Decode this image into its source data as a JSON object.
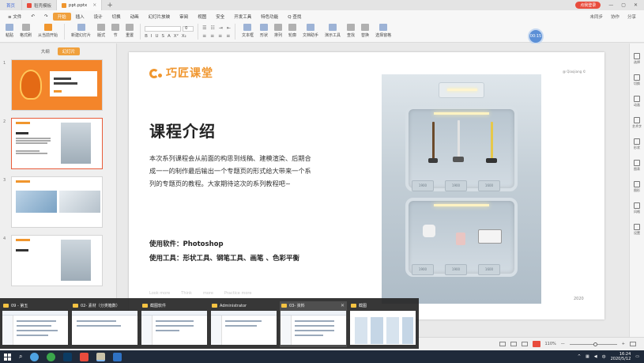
{
  "titlebar": {
    "tabs": [
      {
        "label": "首页",
        "kind": "home"
      },
      {
        "label": "稻壳模板",
        "kind": "docer",
        "color": "#e84c3d"
      },
      {
        "label": "ppt.pptx",
        "kind": "doc",
        "color": "#f0962e"
      }
    ],
    "new_tab": "+",
    "right": {
      "login": "点我登录",
      "badge": "1"
    }
  },
  "menubar": {
    "file": "≡ 文件",
    "items": [
      "开始",
      "插入",
      "设计",
      "切换",
      "动画",
      "幻灯片放映",
      "审阅",
      "视图",
      "安全",
      "开发工具",
      "特色功能"
    ],
    "active": "开始",
    "search": "Q 查找",
    "right": [
      "未同步",
      "协作",
      "分享"
    ]
  },
  "ribbon": {
    "groups": [
      "粘贴",
      "格式刷",
      "当前开始",
      "从当前开始",
      "新建幻灯片",
      "版式",
      "节",
      "重置"
    ],
    "font_placeholder": "",
    "font_size": "0",
    "format_buttons": [
      "B",
      "I",
      "U",
      "S",
      "A",
      "X²",
      "X₂"
    ],
    "right_groups": [
      "文本框",
      "形状",
      "排列",
      "轮廓",
      "文档助手",
      "演示工具",
      "查找",
      "替换",
      "选择窗格"
    ],
    "timer": "00:15"
  },
  "leftpanel": {
    "tabs": [
      "大纲",
      "幻灯片"
    ],
    "active_tab": "幻灯片",
    "slides": [
      {
        "num": "1",
        "title": "电商首页\n松下纤体专题页"
      },
      {
        "num": "2",
        "title": "课程介绍"
      },
      {
        "num": "3",
        "title": ""
      },
      {
        "num": "4",
        "title": "软件及形状"
      }
    ]
  },
  "slide": {
    "brand": "巧匠课堂",
    "copyright": "@ Qiaojiang ©",
    "title": "课程介绍",
    "body": "本次系列课程会从前面的构思到线稿、建模渲染、后期合成一一的制作最后输出一个专题页的形式给大带来一个系列的专题页的教程。大家期待这次的系列教程吧~",
    "software": "使用软件：Photoshop",
    "tools": "使用工具：形状工具、钢笔工具、画笔 、色彩平衡",
    "footer_ghost": [
      "Look more",
      "Think",
      "more",
      "Practice more"
    ],
    "year": "2020",
    "drawer_labels": [
      "1900",
      "1900",
      "1600",
      "1900",
      "1900",
      "1600"
    ]
  },
  "rightbar": {
    "items": [
      "选择",
      "切换",
      "动画",
      "艺术字",
      "形状",
      "图表",
      "图形",
      "风格",
      "设置"
    ]
  },
  "statusbar": {
    "zoom": "110%",
    "zoom_minus": "—",
    "zoom_plus": "+"
  },
  "switcher": {
    "windows": [
      {
        "title": "09 - 第五",
        "closeable": false
      },
      {
        "title": "02- 素材（分类箱数）",
        "closeable": false
      },
      {
        "title": "截图软件",
        "closeable": false
      },
      {
        "title": "Administrator",
        "closeable": false
      },
      {
        "title": "03- 资料",
        "closeable": true
      },
      {
        "title": "截图",
        "closeable": false
      }
    ]
  },
  "taskbar": {
    "time": "16:24",
    "date": "2020/5/12",
    "lang": "中",
    "app_colors": [
      "#4fa3e2",
      "#3aa64b",
      "#0b3c64",
      "#e84c3d",
      "#c9c2a8",
      "#2e72c4"
    ]
  }
}
